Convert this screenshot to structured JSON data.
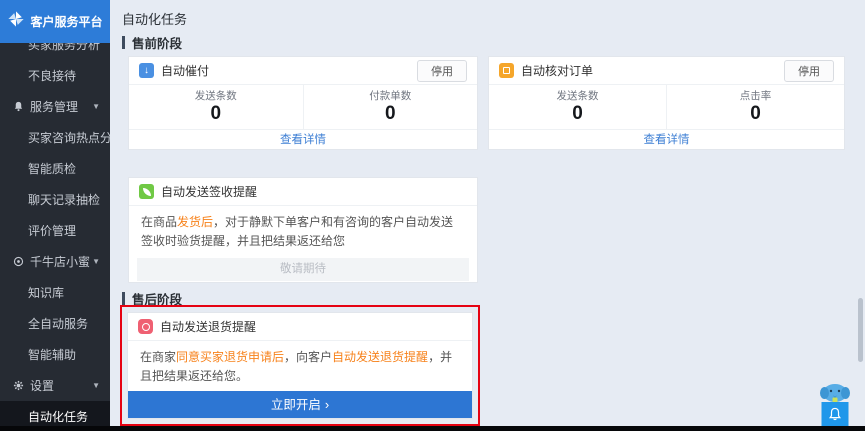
{
  "app": {
    "logo_text": "客户服务平台"
  },
  "sidebar": {
    "items": [
      {
        "label": "买家服务分析",
        "clipped": true
      },
      {
        "label": "不良接待"
      },
      {
        "label": "服务管理",
        "group": true,
        "icon": "bell-icon"
      },
      {
        "label": "买家咨询热点分析"
      },
      {
        "label": "智能质检"
      },
      {
        "label": "聊天记录抽检"
      },
      {
        "label": "评价管理"
      },
      {
        "label": "千牛店小蜜",
        "group": true,
        "icon": "wheel-icon"
      },
      {
        "label": "知识库"
      },
      {
        "label": "全自动服务"
      },
      {
        "label": "智能辅助"
      },
      {
        "label": "设置",
        "group": true,
        "icon": "gear-icon"
      },
      {
        "label": "自动化任务",
        "active": true
      }
    ]
  },
  "main": {
    "page_title": "自动化任务",
    "sections": {
      "pre": "售前阶段",
      "post": "售后阶段"
    },
    "cards": {
      "cuifu": {
        "title": "自动催付",
        "action": "停用",
        "icon": "auto-payment-reminder-icon",
        "stats": [
          {
            "label": "发送条数",
            "value": "0"
          },
          {
            "label": "付款单数",
            "value": "0"
          }
        ],
        "footer_link": "查看详情"
      },
      "hedui": {
        "title": "自动核对订单",
        "action": "停用",
        "icon": "auto-order-check-icon",
        "stats": [
          {
            "label": "发送条数",
            "value": "0"
          },
          {
            "label": "点击率",
            "value": "0"
          }
        ],
        "footer_link": "查看详情"
      },
      "qianshou": {
        "title": "自动发送签收提醒",
        "icon": "auto-receipt-reminder-icon",
        "desc": [
          {
            "t": "在商品"
          },
          {
            "t": "发货后",
            "hl": true
          },
          {
            "t": "，对于静默下单客户和有咨询的客户自动发送签收时验货提醒，并且把结果返还给您"
          }
        ],
        "footer_disabled": "敬请期待"
      },
      "tuihuo": {
        "title": "自动发送退货提醒",
        "icon": "auto-return-reminder-icon",
        "desc": [
          {
            "t": "在商家"
          },
          {
            "t": "同意买家退货申请后",
            "hl": true
          },
          {
            "t": "，向客户"
          },
          {
            "t": "自动发送退货提醒",
            "hl": true
          },
          {
            "t": "，并且把结果返还给您。"
          }
        ],
        "button": "立即开启",
        "button_chevron": "›"
      }
    }
  },
  "colors": {
    "brand_blue": "#2d7cd8",
    "sidebar_bg": "#262b33",
    "accent_orange": "#f7821b",
    "annotation_red": "#e60212",
    "link_blue": "#3e7fd4",
    "button_blue": "#2d76d3"
  }
}
